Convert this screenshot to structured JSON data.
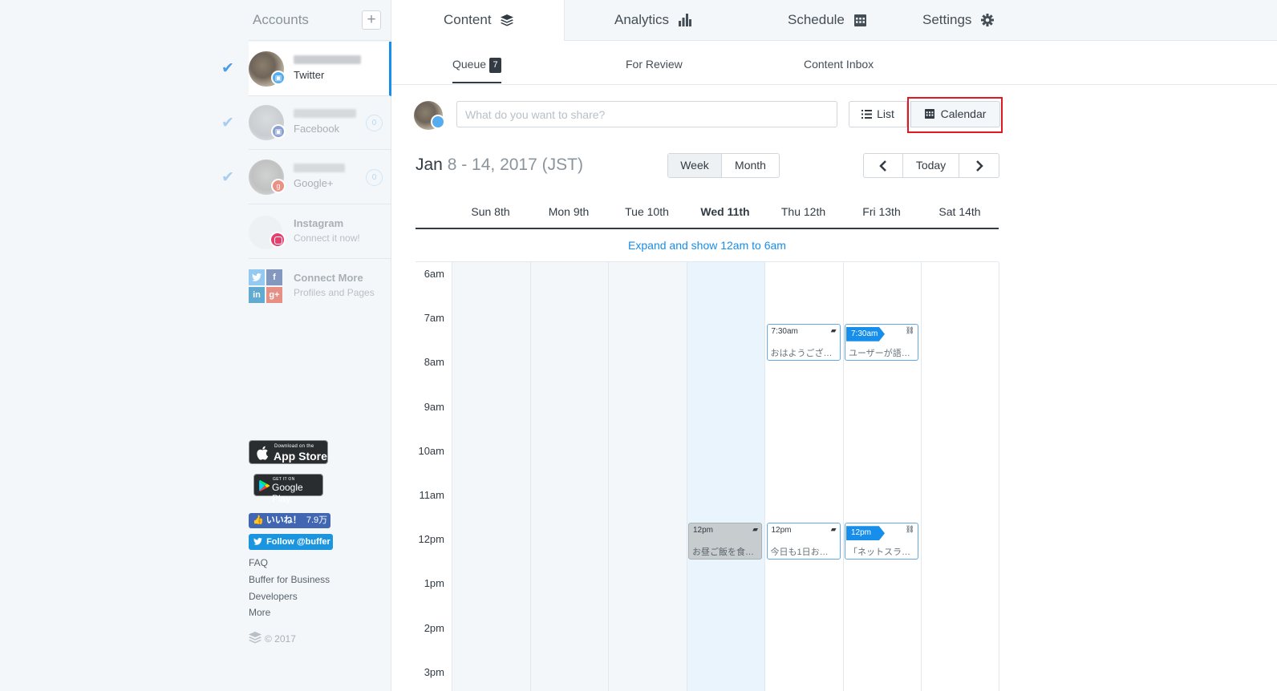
{
  "sidebar": {
    "title": "Accounts",
    "add_icon": "plus-icon",
    "accounts": [
      {
        "network": "Twitter",
        "count": ""
      },
      {
        "network": "Facebook",
        "count": "0"
      },
      {
        "network": "Google+",
        "count": "0"
      }
    ],
    "instagram": {
      "title": "Instagram",
      "subtitle": "Connect it now!"
    },
    "connect_more": {
      "title": "Connect More",
      "subtitle": "Profiles and Pages",
      "tiles": [
        "f",
        "in",
        "g+"
      ]
    },
    "app_store": {
      "small": "Download on the",
      "big": "App Store"
    },
    "google_play": {
      "small": "GET IT ON",
      "big": "Google Play"
    },
    "fb_like": {
      "label": "いいね！",
      "count": "7.9万"
    },
    "tw_follow": "Follow @buffer",
    "footer_links": [
      "FAQ",
      "Buffer for Business",
      "Developers",
      "More"
    ],
    "copyright": "© 2017"
  },
  "nav": {
    "tabs": [
      {
        "label": "Content",
        "icon": "layers-icon"
      },
      {
        "label": "Analytics",
        "icon": "bar-chart-icon"
      },
      {
        "label": "Schedule",
        "icon": "calendar-grid-icon"
      },
      {
        "label": "Settings",
        "icon": "gear-icon"
      }
    ],
    "subtabs": [
      {
        "label": "Queue",
        "badge": "7"
      },
      {
        "label": "For Review"
      },
      {
        "label": "Content Inbox"
      }
    ]
  },
  "composer": {
    "placeholder": "What do you want to share?",
    "list_label": "List",
    "calendar_label": "Calendar"
  },
  "calendar": {
    "month": "Jan",
    "range": "8 - 14, 2017 (JST)",
    "view_week": "Week",
    "view_month": "Month",
    "today_label": "Today",
    "expand_label": "Expand and show 12am to 6am",
    "days": [
      "Sun 8th",
      "Mon 9th",
      "Tue 10th",
      "Wed 11th",
      "Thu 12th",
      "Fri 13th",
      "Sat 14th"
    ],
    "today_index": 3,
    "hours": [
      "6am",
      "7am",
      "8am",
      "9am",
      "10am",
      "11am",
      "12pm",
      "1pm",
      "2pm",
      "3pm"
    ],
    "posts": [
      {
        "day": "Thu 12th",
        "time": "7:30am",
        "text": "おはようござ…",
        "icon": "comment-icon",
        "style": "normal"
      },
      {
        "day": "Fri 13th",
        "time": "7:30am",
        "text": "ユーザーが語…",
        "icon": "link-icon",
        "style": "flag"
      },
      {
        "day": "Wed 11th",
        "time": "12pm",
        "text": "お昼ご飯を食…",
        "icon": "comment-icon",
        "style": "grey"
      },
      {
        "day": "Thu 12th",
        "time": "12pm",
        "text": "今日も1日お…",
        "icon": "comment-icon",
        "style": "normal"
      },
      {
        "day": "Fri 13th",
        "time": "12pm",
        "text": "「ネットスラ…",
        "icon": "link-icon",
        "style": "flag"
      }
    ]
  },
  "colors": {
    "accent": "#168eea",
    "highlight": "#e3171f",
    "text": "#323b43"
  }
}
